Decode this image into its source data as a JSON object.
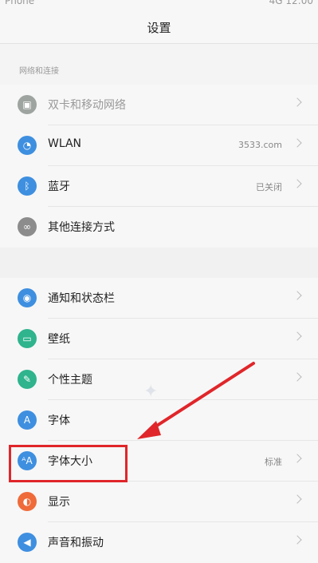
{
  "status": {
    "left": "Phone",
    "right": "4G 12:00"
  },
  "header": {
    "title": "设置"
  },
  "section_network": {
    "label": "网络和连接"
  },
  "network_items": [
    {
      "label": "双卡和移动网络",
      "value": "",
      "icon": "sim-icon",
      "color": "#9ea4a0",
      "dim": true
    },
    {
      "label": "WLAN",
      "value": "3533.com",
      "icon": "wifi-icon",
      "color": "#3e8fe0",
      "dim": false
    },
    {
      "label": "蓝牙",
      "value": "已关闭",
      "icon": "bluetooth-icon",
      "color": "#3e8fe0",
      "dim": false
    },
    {
      "label": "其他连接方式",
      "value": "",
      "icon": "link-icon",
      "color": "#8c8c8c",
      "dim": false
    }
  ],
  "display_items": [
    {
      "label": "通知和状态栏",
      "value": "",
      "icon": "notification-icon",
      "color": "#3e8fe0"
    },
    {
      "label": "壁纸",
      "value": "",
      "icon": "wallpaper-icon",
      "color": "#2fb48d"
    },
    {
      "label": "个性主题",
      "value": "",
      "icon": "theme-icon",
      "color": "#2fb48d"
    },
    {
      "label": "字体",
      "value": "",
      "icon": "font-icon",
      "color": "#3e8fe0"
    },
    {
      "label": "字体大小",
      "value": "标准",
      "icon": "font-size-icon",
      "color": "#3e8fe0"
    },
    {
      "label": "显示",
      "value": "",
      "icon": "display-icon",
      "color": "#ef6b3a"
    },
    {
      "label": "声音和振动",
      "value": "",
      "icon": "sound-icon",
      "color": "#3e8fe0"
    }
  ],
  "accent": {
    "highlight": "#e0262a"
  }
}
